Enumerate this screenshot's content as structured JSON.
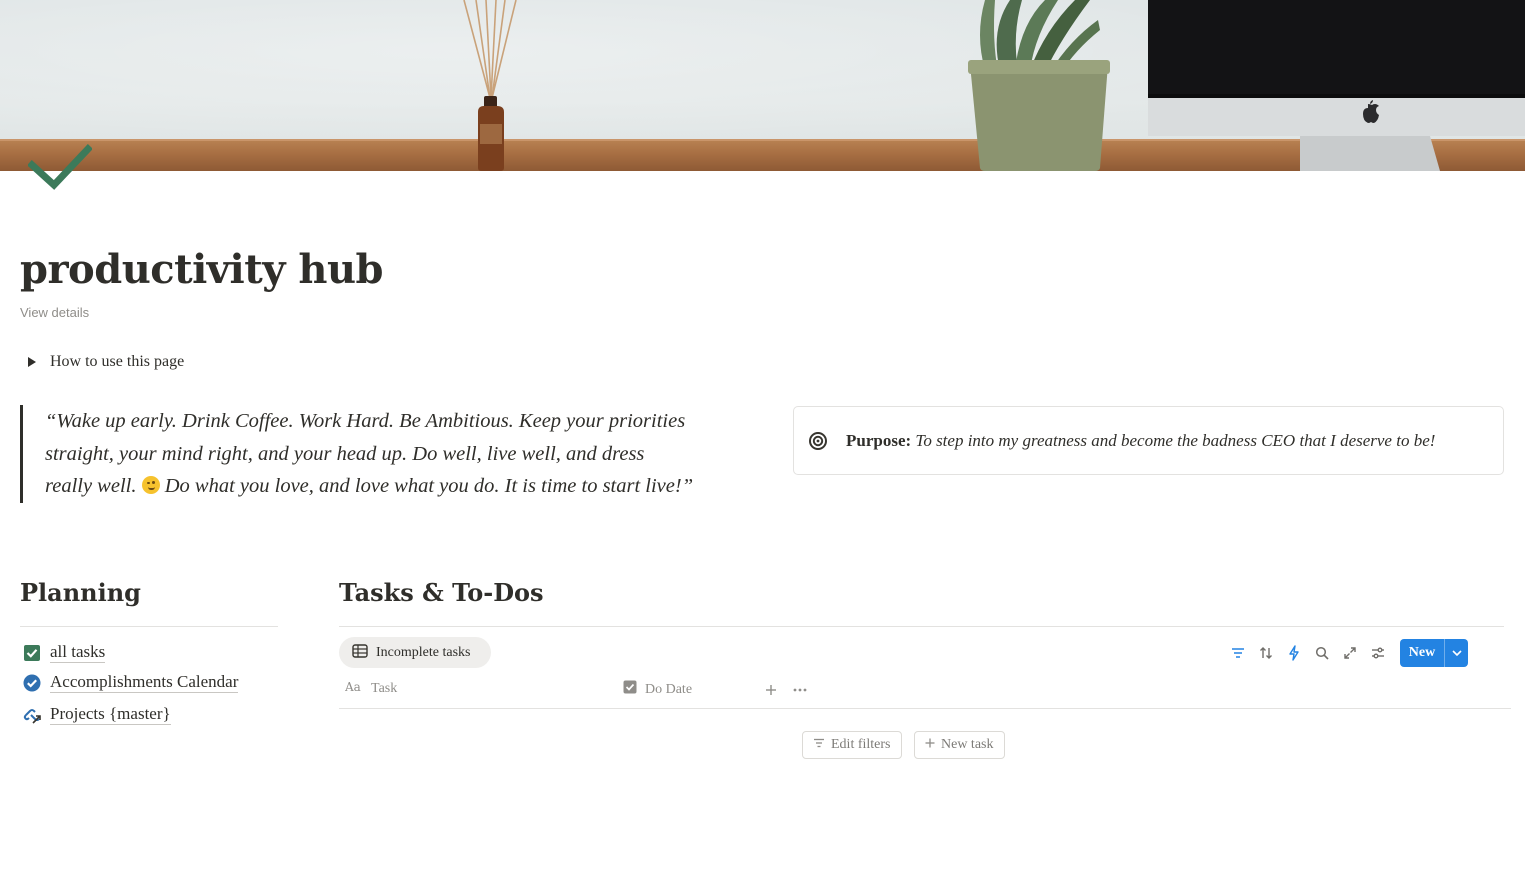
{
  "page": {
    "title": "productivity hub",
    "view_details": "View details",
    "icon": "checkmark-icon"
  },
  "toggle": {
    "label": "How to use this page"
  },
  "quote": {
    "line1": "“Wake up early. Drink Coffee. Work Hard. Be Ambitious. Keep your priorities",
    "line2": "straight, your mind right, and your head up. Do well, live well, and dress",
    "line3a": "really well.",
    "line3b": "Do what you love, and love what you do. It is time to start live!”",
    "emoji": "winking-face"
  },
  "callout": {
    "label": "Purpose:",
    "text": "To step into my greatness and become the badness CEO that I deserve to be!",
    "icon": "target-icon"
  },
  "planning": {
    "title": "Planning",
    "items": [
      {
        "label": "all tasks",
        "icon": "checkbox-icon"
      },
      {
        "label": "Accomplishments Calendar",
        "icon": "check-circle-icon"
      },
      {
        "label": "Projects {master}",
        "icon": "link-arrow-icon"
      }
    ]
  },
  "tasks": {
    "title": "Tasks & To-Dos",
    "view_tab": "Incomplete tasks",
    "new_label": "New",
    "columns": [
      {
        "label": "Task",
        "icon": "text-property-icon"
      },
      {
        "label": "Do Date",
        "icon": "checkbox-property-icon"
      }
    ],
    "edit_filters": "Edit filters",
    "new_task": "New task"
  },
  "colors": {
    "accent": "#2383e2",
    "check_green": "#3c7a5a",
    "text": "#37352f",
    "muted": "#8f8d89"
  }
}
